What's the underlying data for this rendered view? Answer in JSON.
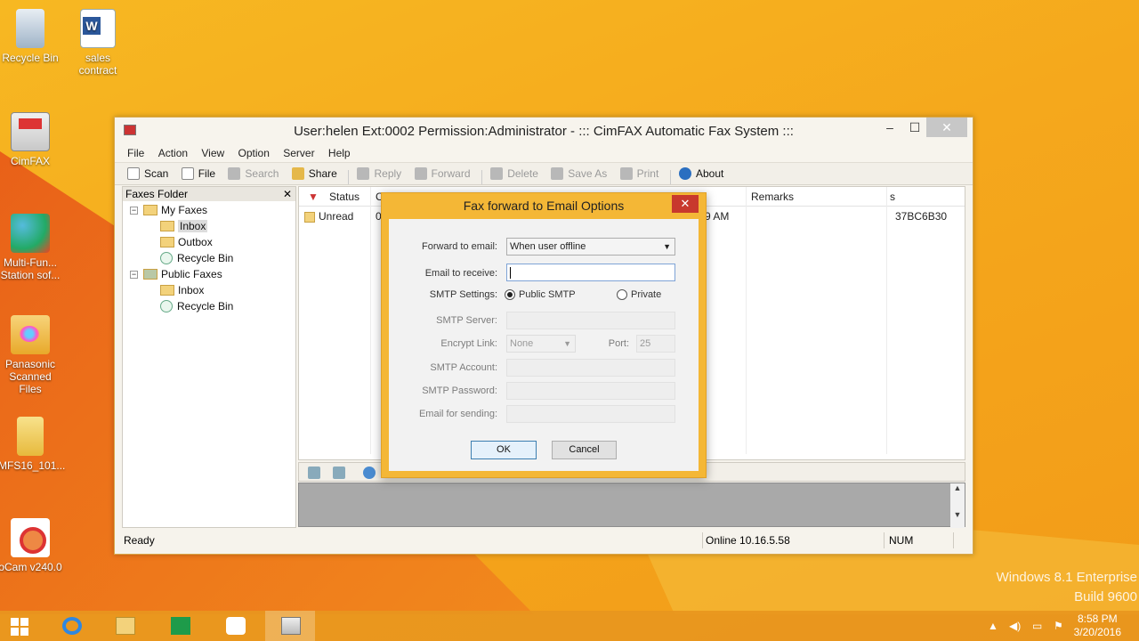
{
  "desktop": {
    "icons": [
      {
        "label": "Recycle Bin"
      },
      {
        "label": "sales contract"
      },
      {
        "label": "CimFAX"
      },
      {
        "label": "Multi-Fun... Station sof..."
      },
      {
        "label": "Panasonic Scanned Files"
      },
      {
        "label": "MFS16_101..."
      },
      {
        "label": "oCam v240.0"
      }
    ],
    "watermark": {
      "line1": "Windows 8.1 Enterprise",
      "line2": "Build 9600"
    }
  },
  "window": {
    "title": "User:helen  Ext:0002  Permission:Administrator - ::: CimFAX Automatic Fax System :::",
    "controls": {
      "minimize": "–",
      "maximize": "☐",
      "close": "✕"
    },
    "menu": [
      "File",
      "Action",
      "View",
      "Option",
      "Server",
      "Help"
    ],
    "toolbar": [
      {
        "label": "Scan",
        "enabled": true
      },
      {
        "label": "File",
        "enabled": true
      },
      {
        "label": "Search",
        "enabled": false
      },
      {
        "label": "Share",
        "enabled": true
      },
      {
        "label": "Reply",
        "enabled": false
      },
      {
        "label": "Forward",
        "enabled": false
      },
      {
        "label": "Delete",
        "enabled": false
      },
      {
        "label": "Save As",
        "enabled": false
      },
      {
        "label": "Print",
        "enabled": false
      },
      {
        "label": "About",
        "enabled": true
      }
    ],
    "folder_pane": {
      "title": "Faxes Folder",
      "close": "✕",
      "tree": [
        {
          "label": "My Faxes",
          "expander": "−"
        },
        {
          "label": "Inbox",
          "selected": true
        },
        {
          "label": "Outbox"
        },
        {
          "label": "Recycle Bin"
        },
        {
          "label": "Public Faxes",
          "expander": "−"
        },
        {
          "label": "Inbox"
        },
        {
          "label": "Recycle Bin"
        }
      ]
    },
    "list": {
      "columns": [
        "Status",
        "C",
        "Remarks",
        "s"
      ],
      "rows": [
        {
          "status": "Unread",
          "c": "0",
          "time": "9 AM",
          "remarks": "",
          "id": "37BC6B30"
        }
      ]
    },
    "statusbar": {
      "left": "Ready",
      "online": "Online 10.16.5.58",
      "num": "NUM"
    }
  },
  "dialog": {
    "title": "Fax forward to Email Options",
    "close": "✕",
    "forward_label": "Forward to email:",
    "forward_value": "When user offline",
    "email_receive_label": "Email to receive:",
    "email_receive_value": "",
    "smtp_settings_label": "SMTP Settings:",
    "smtp_public": "Public SMTP",
    "smtp_private": "Private",
    "smtp_server_label": "SMTP Server:",
    "encrypt_label": "Encrypt Link:",
    "encrypt_value": "None",
    "port_label": "Port:",
    "port_value": "25",
    "smtp_account_label": "SMTP Account:",
    "smtp_password_label": "SMTP Password:",
    "email_sending_label": "Email for sending:",
    "ok": "OK",
    "cancel": "Cancel"
  },
  "taskbar": {
    "clock_time": "8:58 PM",
    "clock_date": "3/20/2016"
  }
}
